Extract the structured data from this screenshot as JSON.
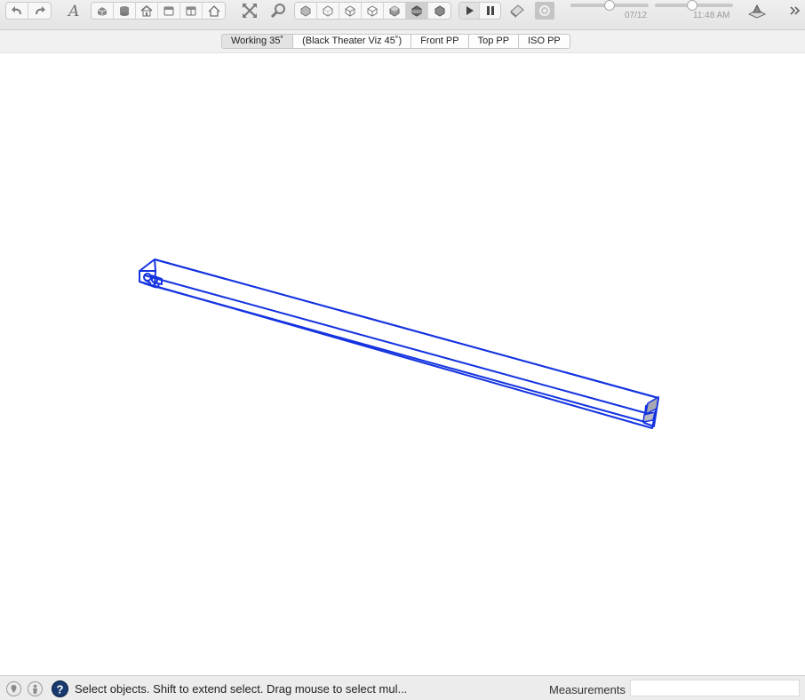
{
  "toolbar": {
    "date_label": "07/12",
    "time_label": "11:48 AM",
    "shadow_date_level": 0.5,
    "shadow_time_level": 0.48
  },
  "scenes": {
    "tabs": [
      "Working  35˚",
      "(Black Theater Viz 45˚)",
      "Front PP",
      "Top PP",
      "ISO PP"
    ],
    "active_index": 0
  },
  "viewport": {
    "selection_color": "#1433e0",
    "background": "#ffffff"
  },
  "statusbar": {
    "message": "Select objects. Shift to extend select. Drag mouse to select mul...",
    "measurements_label": "Measurements",
    "measurements_value": ""
  }
}
